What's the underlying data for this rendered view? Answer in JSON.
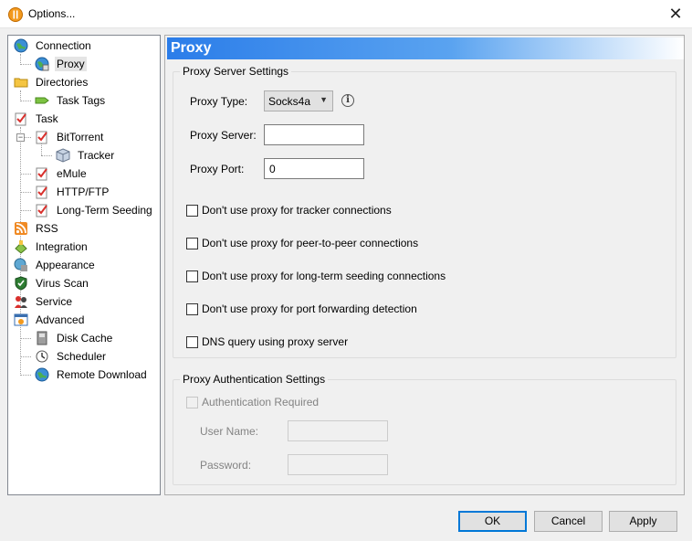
{
  "window": {
    "title": "Options...",
    "close_symbol": "✕"
  },
  "tree": {
    "items": [
      {
        "label": "Connection",
        "icon": "globe-icon"
      },
      {
        "label": "Proxy",
        "icon": "proxy-globe-icon",
        "selected": true
      },
      {
        "label": "Directories",
        "icon": "folder-icon"
      },
      {
        "label": "Task Tags",
        "icon": "tag-icon"
      },
      {
        "label": "Task",
        "icon": "task-icon"
      },
      {
        "label": "BitTorrent",
        "icon": "task-icon"
      },
      {
        "label": "Tracker",
        "icon": "cube-icon"
      },
      {
        "label": "eMule",
        "icon": "task-icon"
      },
      {
        "label": "HTTP/FTP",
        "icon": "task-icon"
      },
      {
        "label": "Long-Term Seeding",
        "icon": "task-icon"
      },
      {
        "label": "RSS",
        "icon": "rss-icon"
      },
      {
        "label": "Integration",
        "icon": "integration-icon"
      },
      {
        "label": "Appearance",
        "icon": "appearance-icon"
      },
      {
        "label": "Virus Scan",
        "icon": "shield-icon"
      },
      {
        "label": "Service",
        "icon": "service-icon"
      },
      {
        "label": "Advanced",
        "icon": "advanced-icon"
      },
      {
        "label": "Disk Cache",
        "icon": "disk-icon"
      },
      {
        "label": "Scheduler",
        "icon": "scheduler-icon"
      },
      {
        "label": "Remote Download",
        "icon": "remote-globe-icon"
      }
    ]
  },
  "panel": {
    "header": "Proxy",
    "proxy_server_settings": {
      "title": "Proxy Server Settings",
      "proxy_type_label": "Proxy Type:",
      "proxy_type_value": "Socks4a",
      "proxy_server_label": "Proxy Server:",
      "proxy_server_value": "",
      "proxy_port_label": "Proxy Port:",
      "proxy_port_value": "0",
      "options": [
        {
          "label": "Don't use proxy for tracker connections",
          "checked": false
        },
        {
          "label": "Don't use proxy for peer-to-peer connections",
          "checked": false
        },
        {
          "label": "Don't use proxy for long-term seeding connections",
          "checked": false
        },
        {
          "label": "Don't use proxy for port forwarding detection",
          "checked": false
        },
        {
          "label": "DNS query using proxy server",
          "checked": false
        }
      ]
    },
    "auth_settings": {
      "title": "Proxy Authentication Settings",
      "auth_required_label": "Authentication Required",
      "auth_required_checked": false,
      "username_label": "User Name:",
      "username_value": "",
      "password_label": "Password:",
      "password_value": ""
    }
  },
  "buttons": {
    "ok": "OK",
    "cancel": "Cancel",
    "apply": "Apply"
  },
  "colors": {
    "accent": "#0078d7",
    "header_gradient_start": "#2b7de9"
  }
}
